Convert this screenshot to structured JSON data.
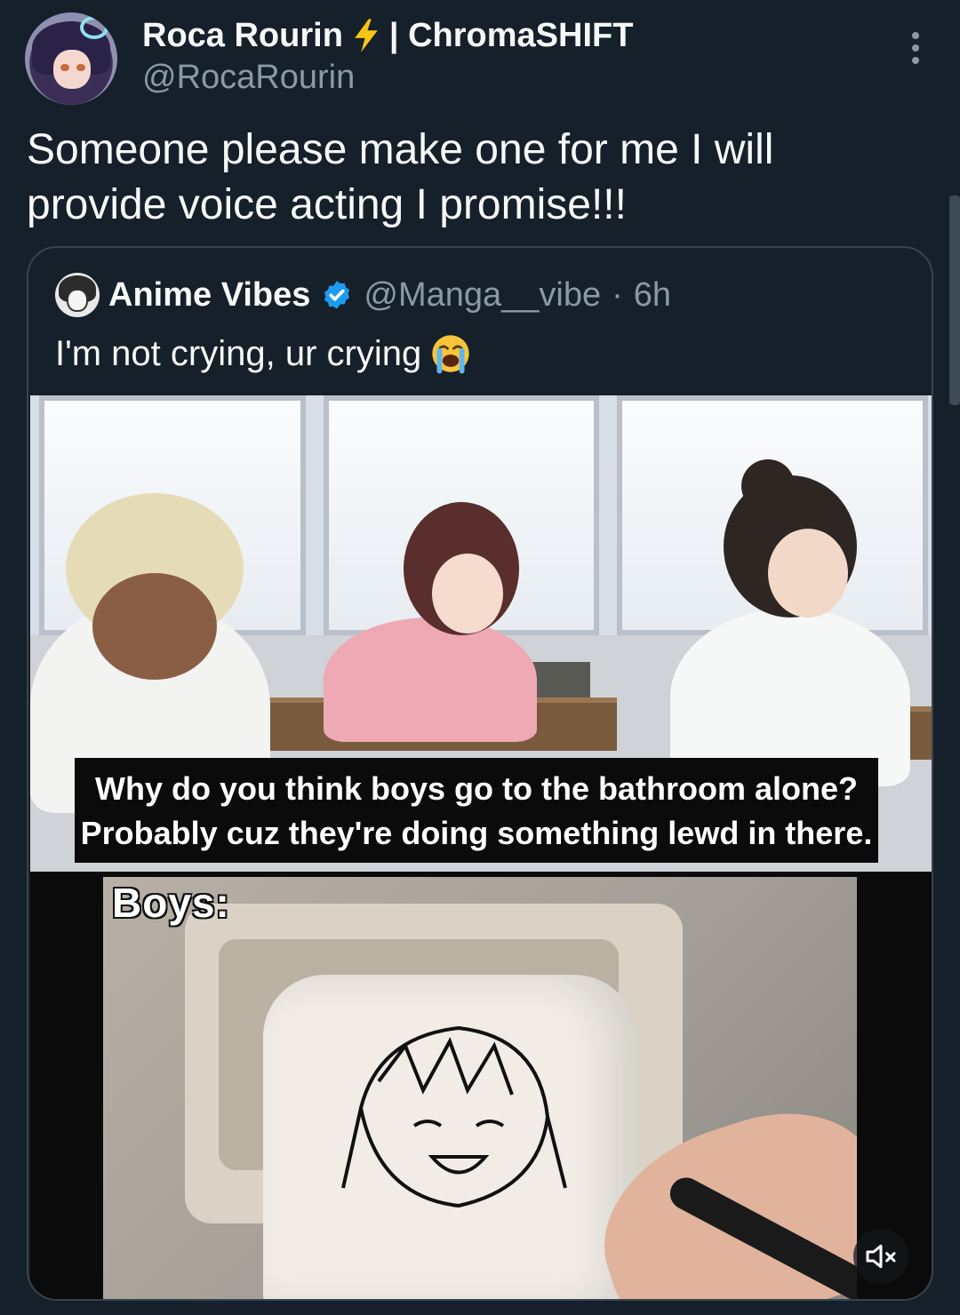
{
  "author": {
    "display_name": "Roca Rourin",
    "name_suffix": "| ChromaSHIFT",
    "handle": "@RocaRourin"
  },
  "tweet": {
    "text": "Someone please make one for me I will provide voice acting I promise!!!"
  },
  "quoted": {
    "display_name": "Anime Vibes",
    "handle": "@Manga__vibe",
    "separator": "·",
    "time": "6h",
    "text": "I'm not crying, ur crying",
    "emoji": "😭",
    "verified": true
  },
  "media": {
    "caption_line1": "Why do you think boys go to the bathroom alone?",
    "caption_line2": "Probably cuz they're doing something lewd in there.",
    "overlay_label": "Boys:",
    "muted": true
  },
  "icons": {
    "bolt": "lightning-bolt-icon",
    "more": "more-options-icon",
    "verified": "verified-badge-icon",
    "mute": "speaker-muted-icon"
  },
  "colors": {
    "background": "#15202b",
    "text_primary": "#f7f9f9",
    "text_secondary": "#8b98a5",
    "border": "#38444d",
    "verified_blue": "#1d9bf0",
    "bolt_yellow": "#f5c518"
  }
}
